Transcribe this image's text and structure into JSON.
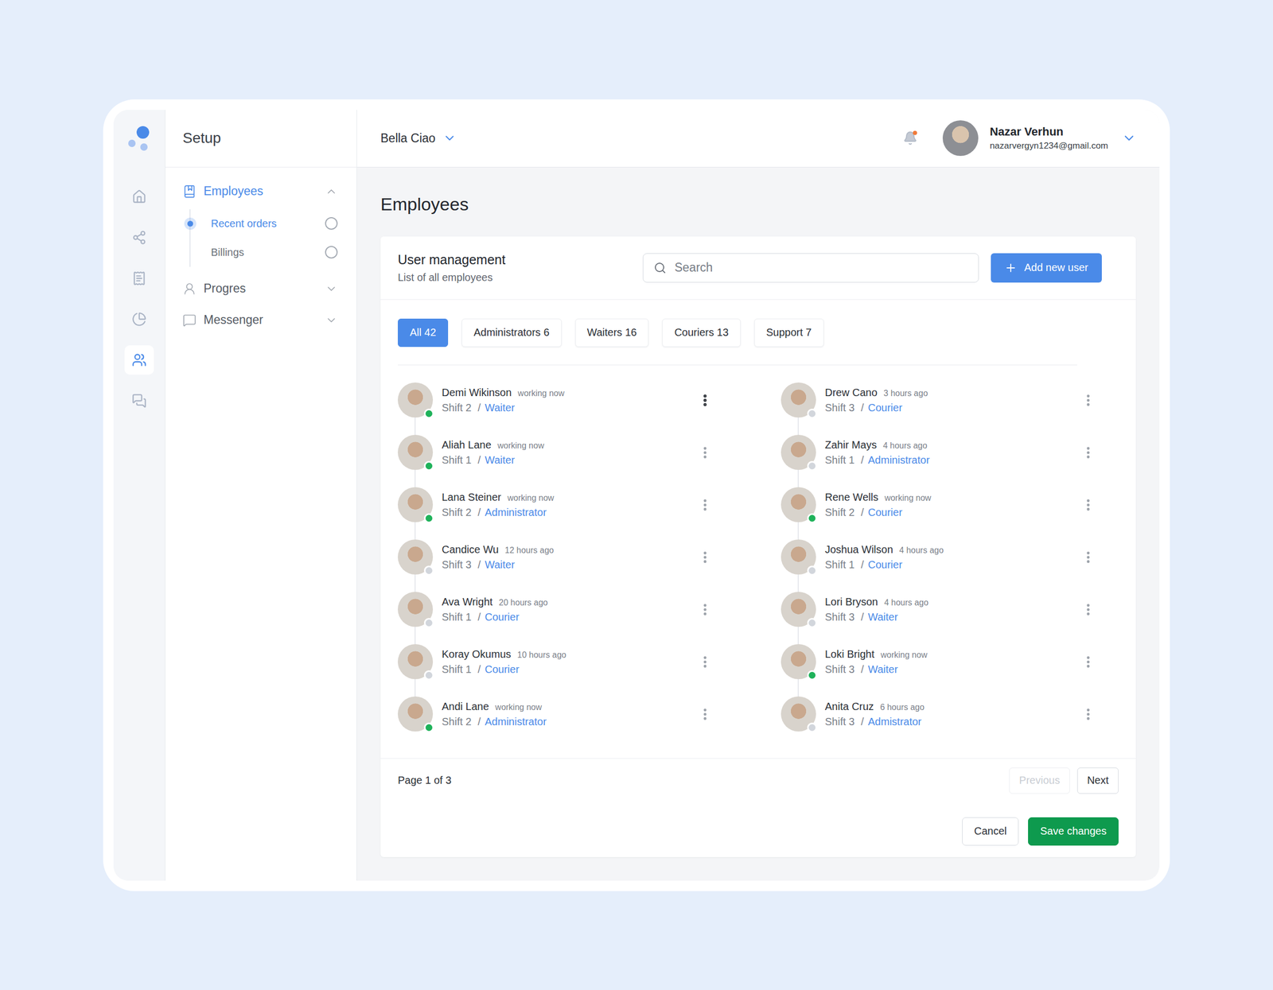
{
  "rail": [
    {
      "selected": false
    },
    {
      "selected": false
    },
    {
      "selected": false
    },
    {
      "selected": false
    },
    {
      "selected": true
    },
    {
      "selected": false
    }
  ],
  "setup": {
    "title": "Setup",
    "groups": [
      {
        "label": "Employees",
        "expanded": true,
        "selected": true,
        "items": [
          {
            "label": "Recent orders",
            "selected": true
          },
          {
            "label": "Billings",
            "selected": false
          }
        ]
      },
      {
        "label": "Progres",
        "expanded": false,
        "selected": false,
        "items": []
      },
      {
        "label": "Messenger",
        "expanded": false,
        "selected": false,
        "items": []
      }
    ]
  },
  "header": {
    "workspace": "Bella Ciao",
    "notifications": {
      "unread": true
    },
    "user": {
      "name": "Nazar Verhun",
      "email": "nazarvergyn1234@gmail.com"
    }
  },
  "page": {
    "title": "Employees"
  },
  "card": {
    "title": "User management",
    "subtitle": "List of all employees",
    "search": {
      "placeholder": "Search"
    },
    "add_button": "Add new user"
  },
  "filters": [
    {
      "label": "All 42",
      "selected": true
    },
    {
      "label": "Administrators 6",
      "selected": false
    },
    {
      "label": "Waiters 16",
      "selected": false
    },
    {
      "label": "Couriers 13",
      "selected": false
    },
    {
      "label": "Support 7",
      "selected": false
    }
  ],
  "role_separator": "/",
  "employees": [
    {
      "name": "Demi Wikinson",
      "time": "working now",
      "shift": "Shift 2",
      "role": "Waiter",
      "online": true,
      "menu_highlighted": true
    },
    {
      "name": "Aliah Lane",
      "time": "working now",
      "shift": "Shift 1",
      "role": "Waiter",
      "online": true,
      "menu_highlighted": false
    },
    {
      "name": "Lana Steiner",
      "time": "working now",
      "shift": "Shift 2",
      "role": "Administrator",
      "online": true,
      "menu_highlighted": false
    },
    {
      "name": "Candice Wu",
      "time": "12 hours ago",
      "shift": "Shift 3",
      "role": "Waiter",
      "online": false,
      "menu_highlighted": false
    },
    {
      "name": "Ava Wright",
      "time": "20 hours ago",
      "shift": "Shift 1",
      "role": "Courier",
      "online": false,
      "menu_highlighted": false
    },
    {
      "name": "Koray Okumus",
      "time": "10 hours ago",
      "shift": "Shift 1",
      "role": "Courier",
      "online": false,
      "menu_highlighted": false
    },
    {
      "name": "Andi Lane",
      "time": "working now",
      "shift": "Shift 2",
      "role": "Administrator",
      "online": true,
      "menu_highlighted": false
    },
    {
      "name": "Drew Cano",
      "time": "3 hours ago",
      "shift": "Shift 3",
      "role": "Courier",
      "online": false,
      "menu_highlighted": false
    },
    {
      "name": "Zahir Mays",
      "time": "4 hours ago",
      "shift": "Shift 1",
      "role": "Administrator",
      "online": false,
      "menu_highlighted": false
    },
    {
      "name": "Rene Wells",
      "time": "working now",
      "shift": "Shift 2",
      "role": "Courier",
      "online": true,
      "menu_highlighted": false
    },
    {
      "name": "Joshua Wilson",
      "time": "4 hours ago",
      "shift": "Shift 1",
      "role": "Courier",
      "online": false,
      "menu_highlighted": false
    },
    {
      "name": "Lori Bryson",
      "time": "4 hours ago",
      "shift": "Shift 3",
      "role": "Waiter",
      "online": false,
      "menu_highlighted": false
    },
    {
      "name": "Loki Bright",
      "time": "working now",
      "shift": "Shift 3",
      "role": "Waiter",
      "online": true,
      "menu_highlighted": false
    },
    {
      "name": "Anita Cruz",
      "time": "6 hours ago",
      "shift": "Shift 3",
      "role": "Admistrator",
      "online": false,
      "menu_highlighted": false
    }
  ],
  "pagination": {
    "label": "Page 1 of 3",
    "previous": {
      "label": "Previous",
      "disabled": true
    },
    "next": {
      "label": "Next",
      "disabled": false
    }
  },
  "buttons": [
    {
      "label": "Cancel",
      "kind": "secondary"
    },
    {
      "label": "Save changes",
      "kind": "primary"
    }
  ]
}
